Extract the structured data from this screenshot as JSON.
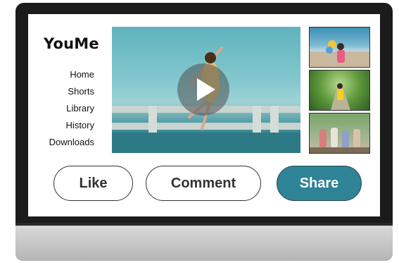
{
  "app": {
    "logo": "YouMe"
  },
  "nav": {
    "items": [
      "Home",
      "Shorts",
      "Library",
      "History",
      "Downloads"
    ]
  },
  "video": {
    "play_icon": "play-icon"
  },
  "thumbnails": [
    {
      "icon": "video-thumbnail"
    },
    {
      "icon": "video-thumbnail"
    },
    {
      "icon": "video-thumbnail"
    }
  ],
  "actions": {
    "like_label": "Like",
    "comment_label": "Comment",
    "share_label": "Share"
  },
  "colors": {
    "share_button": "#2e8396",
    "frame": "#1b1b1b"
  }
}
